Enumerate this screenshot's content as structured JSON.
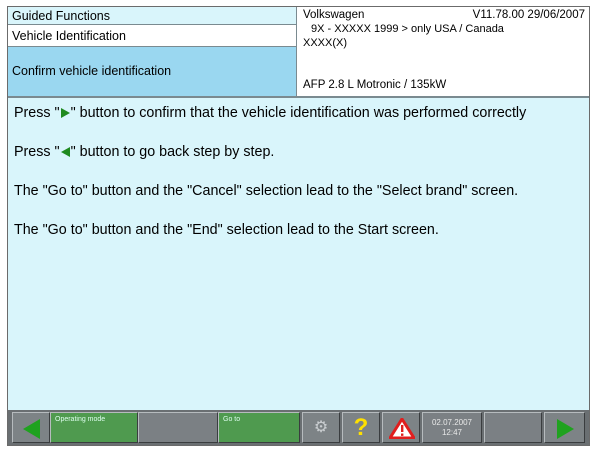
{
  "header": {
    "section": "Guided Functions",
    "subsection": "Vehicle Identification",
    "step": "Confirm vehicle identification",
    "brand": "Volkswagen",
    "version": "V11.78.00 29/06/2007",
    "model_line": "9X - XXXXX 1999 > only USA / Canada",
    "model_code": "XXXX(X)",
    "engine": "AFP 2.8 L Motronic / 135kW"
  },
  "content": {
    "line1_pre": "Press \"",
    "line1_post": "\" button to confirm that the vehicle identification was performed correctly",
    "line2_pre": "Press \"",
    "line2_post": "\" button to go back step by step.",
    "line3": "The \"Go to\" button and the \"Cancel\" selection lead to the \"Select brand\" screen.",
    "line4": "The \"Go to\" button and the \"End\" selection lead to the Start screen."
  },
  "toolbar": {
    "operating_mode_label": "Operating mode",
    "goto_label": "Go to",
    "date": "02.07.2007",
    "time": "12:47"
  },
  "icons": {
    "back": "triangle-left-green",
    "next": "triangle-right-green",
    "help": "question-mark-yellow",
    "warning": "warning-triangle-red",
    "tools": "wrench-gear-icon"
  },
  "colors": {
    "background": "#d9f5fb",
    "selected_step": "#9ad7f0",
    "toolbar": "#6a6f72",
    "arrow_green": "#1fa21f",
    "mode_button_green": "#4f9a4f"
  }
}
